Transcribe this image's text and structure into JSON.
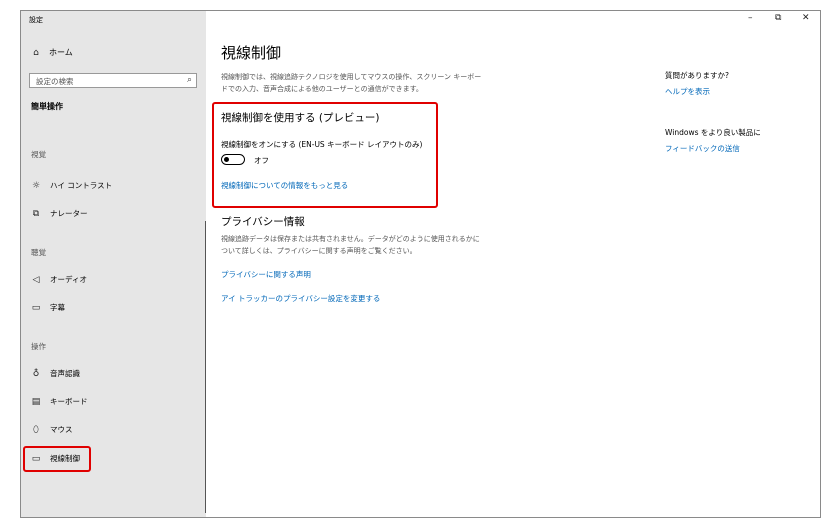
{
  "window": {
    "title": "設定",
    "controls": {
      "minimize": "–",
      "maximize": "⧉",
      "close": "✕"
    }
  },
  "sidebar": {
    "home_label": "ホーム",
    "search_placeholder": "設定の検索",
    "category": "簡単操作",
    "groups": {
      "vision": "視覚",
      "hearing": "聴覚",
      "interaction": "操作"
    },
    "items": {
      "high_contrast": "ハイ コントラスト",
      "narrator": "ナレーター",
      "audio": "オーディオ",
      "captions": "字幕",
      "speech": "音声認識",
      "keyboard": "キーボード",
      "mouse": "マウス",
      "eye_control": "視線制御"
    }
  },
  "main": {
    "title": "視線制御",
    "description": "視線制御では、視線追跡テクノロジを使用してマウスの操作、スクリーン キーボードでの入力、音声合成による他のユーザーとの通信ができます。",
    "section1": {
      "heading": "視線制御を使用する (プレビュー)",
      "toggle_label": "視線制御をオンにする (EN-US キーボード レイアウトのみ)",
      "toggle_state": "オフ",
      "toggle_on": false,
      "link": "視線制御についての情報をもっと見る"
    },
    "privacy": {
      "heading": "プライバシー情報",
      "text": "視線追跡データは保存または共有されません。データがどのように使用されるかについて詳しくは、プライバシーに関する声明をご覧ください。",
      "link1": "プライバシーに関する声明",
      "link2": "アイ トラッカーのプライバシー設定を変更する"
    }
  },
  "right": {
    "question": "質問がありますか?",
    "help_link": "ヘルプを表示",
    "improve": "Windows をより良い製品に",
    "feedback_link": "フィードバックの送信"
  },
  "colors": {
    "accent": "#0067b8",
    "highlight": "#e00000",
    "sidebar_bg": "#e6e6e6"
  }
}
